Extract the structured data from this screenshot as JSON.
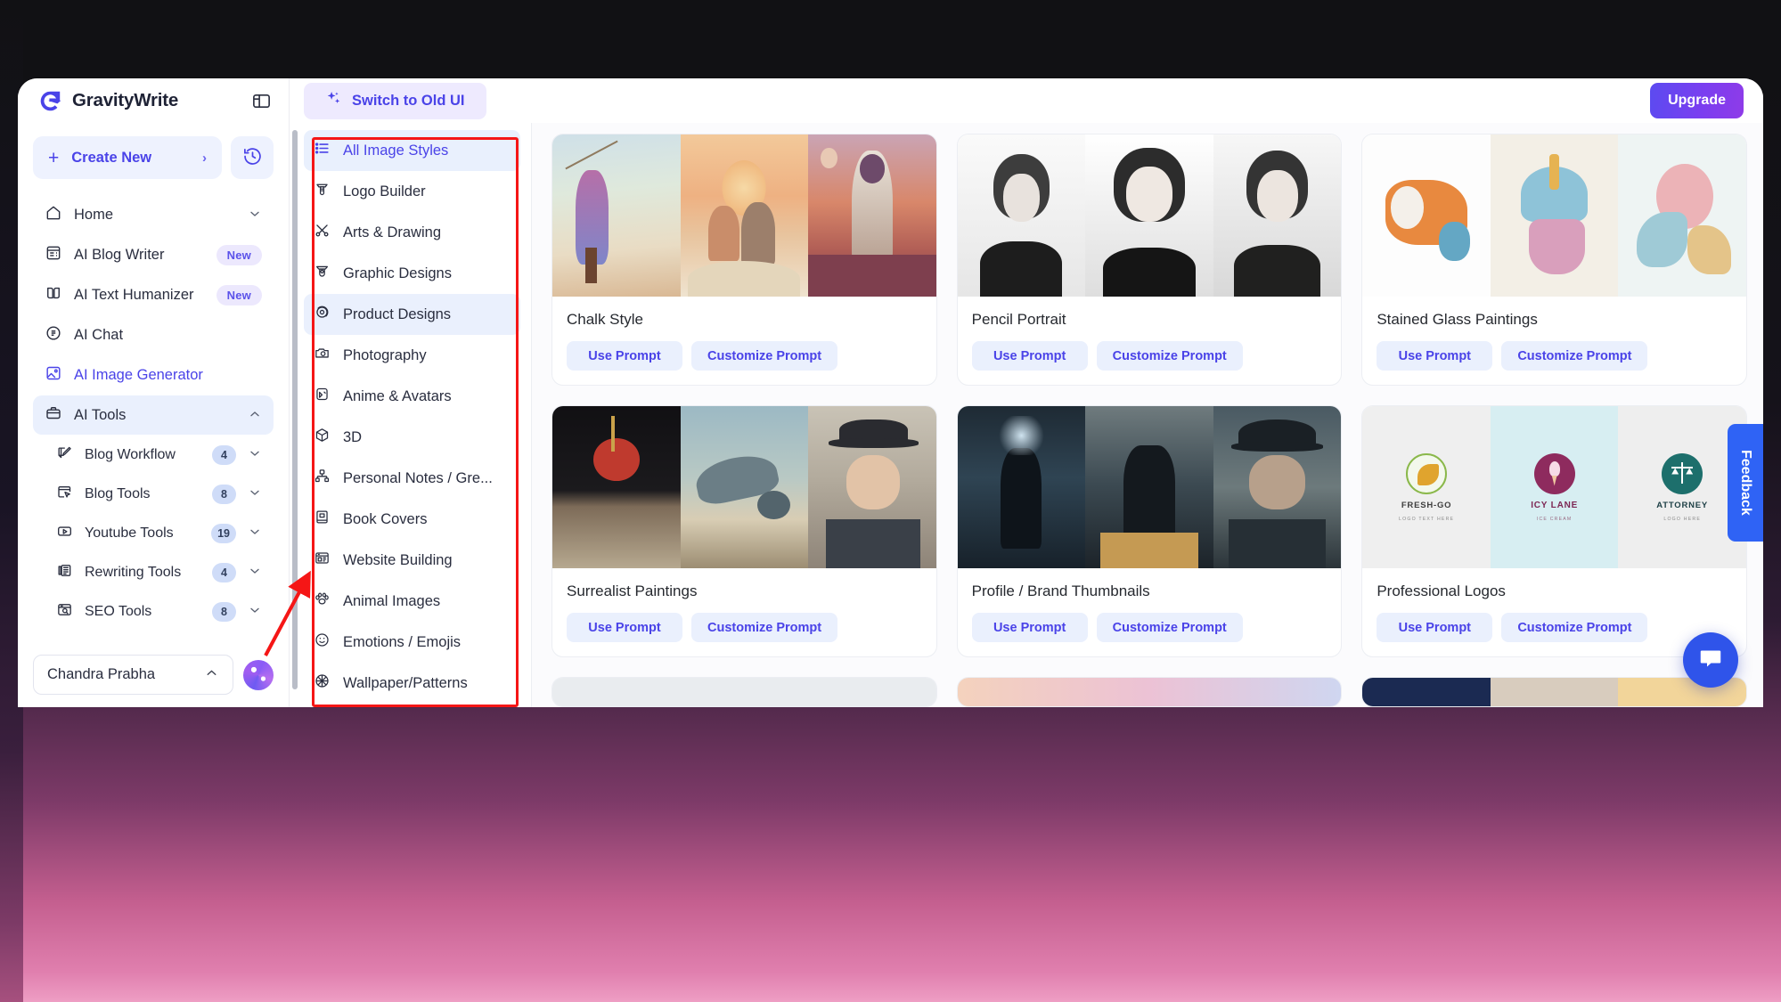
{
  "window": {
    "brand": "GravityWrite",
    "panel_toggle_icon": "panel-layout-icon",
    "switch_ui_label": "Switch to Old UI",
    "upgrade_label": "Upgrade"
  },
  "sidebar": {
    "create_new": {
      "label": "Create New",
      "plus": "+",
      "chevron": "›"
    },
    "history_icon": "history-clock-icon",
    "nav": [
      {
        "label": "Home",
        "icon": "home-icon",
        "badge": "",
        "chevron": "⌄",
        "state": "default"
      },
      {
        "label": "AI Blog Writer",
        "icon": "blog-writer-icon",
        "badge": "New",
        "chevron": "",
        "state": "default"
      },
      {
        "label": "AI Text Humanizer",
        "icon": "book-open-icon",
        "badge": "New",
        "chevron": "",
        "state": "default"
      },
      {
        "label": "AI Chat",
        "icon": "chat-doc-icon",
        "badge": "",
        "chevron": "",
        "state": "default"
      },
      {
        "label": "AI Image Generator",
        "icon": "image-icon",
        "badge": "",
        "chevron": "",
        "state": "active"
      },
      {
        "label": "AI Tools",
        "icon": "briefcase-icon",
        "badge": "",
        "chevron": "⌃",
        "state": "selected"
      }
    ],
    "sub_nav": [
      {
        "label": "Blog Workflow",
        "icon": "edit-square-icon",
        "count": "4",
        "chevron": "⌄"
      },
      {
        "label": "Blog Tools",
        "icon": "cursor-window-icon",
        "count": "8",
        "chevron": "⌄"
      },
      {
        "label": "Youtube Tools",
        "icon": "play-box-icon",
        "count": "19",
        "chevron": "⌄"
      },
      {
        "label": "Rewriting Tools",
        "icon": "news-icon",
        "count": "4",
        "chevron": "⌄"
      },
      {
        "label": "SEO Tools",
        "icon": "search-window-icon",
        "count": "8",
        "chevron": "⌄"
      }
    ],
    "account": {
      "name": "Chandra Prabha",
      "chevron": "⌃",
      "avatar_icon": "avatar-orb"
    }
  },
  "styles_panel": {
    "items": [
      {
        "label": "All Image Styles",
        "icon": "list-icon",
        "state": "active"
      },
      {
        "label": "Logo Builder",
        "icon": "logo-builder-icon",
        "state": "default"
      },
      {
        "label": "Arts & Drawing",
        "icon": "brush-pencil-icon",
        "state": "default"
      },
      {
        "label": "Graphic Designs",
        "icon": "graphic-design-icon",
        "state": "default"
      },
      {
        "label": "Product Designs",
        "icon": "product-atom-icon",
        "state": "hover"
      },
      {
        "label": "Photography",
        "icon": "camera-icon",
        "state": "default"
      },
      {
        "label": "Anime & Avatars",
        "icon": "anime-avatar-icon",
        "state": "default"
      },
      {
        "label": "3D",
        "icon": "cube-icon",
        "state": "default"
      },
      {
        "label": "Personal Notes / Gre...",
        "icon": "notes-icon",
        "state": "default"
      },
      {
        "label": "Book Covers",
        "icon": "book-icon",
        "state": "default"
      },
      {
        "label": "Website Building",
        "icon": "website-icon",
        "state": "default"
      },
      {
        "label": "Animal Images",
        "icon": "animal-icon",
        "state": "default"
      },
      {
        "label": "Emotions / Emojis",
        "icon": "smiley-icon",
        "state": "default"
      },
      {
        "label": "Wallpaper/Patterns",
        "icon": "wallpaper-icon",
        "state": "default"
      }
    ]
  },
  "gallery": {
    "use_prompt_label": "Use Prompt",
    "customize_prompt_label": "Customize Prompt",
    "cards": [
      {
        "title": "Chalk Style"
      },
      {
        "title": "Pencil Portrait"
      },
      {
        "title": "Stained Glass Paintings"
      },
      {
        "title": "Surrealist Paintings"
      },
      {
        "title": "Profile / Brand Thumbnails"
      },
      {
        "title": "Professional Logos"
      }
    ]
  },
  "overlays": {
    "feedback_label": "Feedback",
    "chat_icon": "chat-bubble-icon"
  },
  "logos_card": {
    "items": [
      {
        "name": "FRESH-GO",
        "sub": "LOGO TEXT HERE"
      },
      {
        "name": "ICY LANE",
        "sub": "ICE CREAM"
      },
      {
        "name": "ATTORNEY",
        "sub": "LOGO HERE"
      }
    ]
  },
  "colors": {
    "accent": "#4a43e8",
    "annotation": "#f51616",
    "feedback": "#2f63f5",
    "chat": "#2f54ea"
  }
}
